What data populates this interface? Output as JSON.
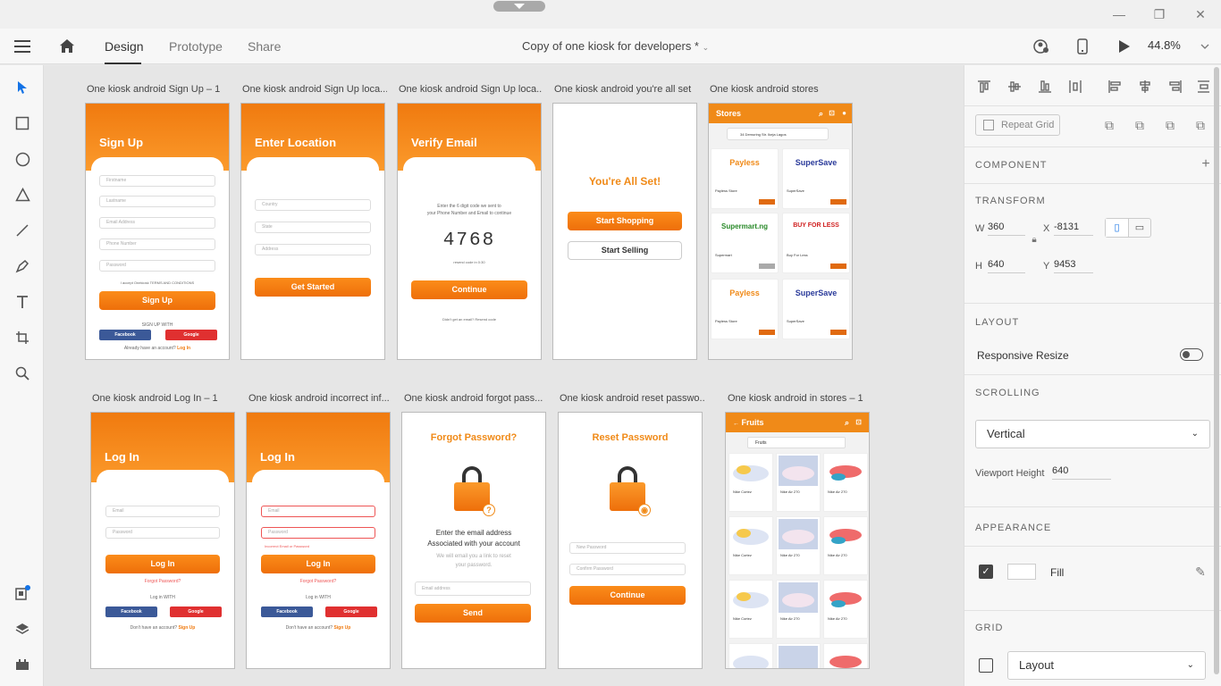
{
  "window": {
    "minimize": "—",
    "restore": "❐",
    "close": "✕"
  },
  "topbar": {
    "tabs": [
      "Design",
      "Prototype",
      "Share"
    ],
    "doc_title": "Copy of one kiosk for developers *",
    "zoom": "44.8%"
  },
  "artboards": {
    "signup": {
      "label": "One kiosk android Sign Up – 1",
      "title": "Sign Up",
      "fields": [
        "Firstname",
        "Lastname",
        "Email Address",
        "Phone Number",
        "Password"
      ],
      "terms": "I accept Onekiosk TERMS AND CONDITIONS",
      "button": "Sign Up",
      "signup_with": "SIGN UP WITH",
      "facebook": "Facebook",
      "google": "Google",
      "have_account": "Already have an account?",
      "login_link": "Log In"
    },
    "location": {
      "label": "One kiosk android Sign Up loca...",
      "title": "Enter Location",
      "fields": [
        "Country",
        "State",
        "Address"
      ],
      "button": "Get Started"
    },
    "verify": {
      "label": "One kiosk android Sign Up loca...",
      "title": "Verify Email",
      "desc1": "Enter the 6 digit code we sent to",
      "desc2": "your Phone Number and Email to continue",
      "code": "4768",
      "resend": "resend code in 0:30",
      "button": "Continue",
      "no_email": "Didn't get an email? Resend code"
    },
    "allset": {
      "label": "One kiosk android you're all set",
      "title": "You're All Set!",
      "btn_shop": "Start Shopping",
      "btn_sell": "Start Selling"
    },
    "stores": {
      "label": "One kiosk android stores",
      "title": "Stores",
      "location": "34 Demuring Str. Ikeja Lagos",
      "cards": [
        {
          "logo": "Payless",
          "name": "Payless Store",
          "color": "#f08a18"
        },
        {
          "logo": "SuperSave",
          "name": "SuperSave",
          "color": "#2a3a9a"
        },
        {
          "logo": "Supermart.ng",
          "name": "Supermart",
          "color": "#2a8a2a"
        },
        {
          "logo": "BUY FOR LESS",
          "name": "Buy For Less",
          "color": "#d02020"
        },
        {
          "logo": "Payless",
          "name": "Payless Store",
          "color": "#f08a18"
        },
        {
          "logo": "SuperSave",
          "name": "SuperSave",
          "color": "#2a3a9a"
        }
      ]
    },
    "login": {
      "label": "One kiosk android Log In – 1",
      "title": "Log In",
      "fields": [
        "Email",
        "Password"
      ],
      "button": "Log In",
      "forgot": "Forgot Password?",
      "login_with": "Log in WITH",
      "facebook": "Facebook",
      "google": "Google",
      "no_account": "Don't have an account?",
      "signup_link": "Sign Up"
    },
    "incorrect": {
      "label": "One kiosk android incorrect inf...",
      "title": "Log In",
      "fields": [
        "Email",
        "Password"
      ],
      "error": "Incorrect Email or Password",
      "button": "Log In",
      "forgot": "Forgot Password?",
      "login_with": "Log in WITH",
      "facebook": "Facebook",
      "google": "Google",
      "no_account": "Don't have an account?",
      "signup_link": "Sign Up"
    },
    "forgot": {
      "label": "One kiosk android forgot pass...",
      "title": "Forgot Password?",
      "desc1": "Enter the email address",
      "desc2": "Associated with your account",
      "desc3": "We will email you a link to reset",
      "desc4": "your password.",
      "field": "Email address",
      "button": "Send",
      "badge": "?"
    },
    "reset": {
      "label": "One kiosk android reset passwo...",
      "title": "Reset Password",
      "fields": [
        "New Password",
        "Confirm Password"
      ],
      "button": "Continue",
      "badge": "◉"
    },
    "fruits": {
      "label": "One kiosk android in stores – 1",
      "title": "Fruits",
      "filter": "Fruits",
      "items": [
        "Nike Cortez",
        "Nike Air 270",
        "Nike Air 270"
      ]
    }
  },
  "panel": {
    "repeat_grid": "Repeat Grid",
    "component": "COMPONENT",
    "transform": "TRANSFORM",
    "w_label": "W",
    "w": "360",
    "x_label": "X",
    "x": "-8131",
    "h_label": "H",
    "h": "640",
    "y_label": "Y",
    "y": "9453",
    "layout": "LAYOUT",
    "responsive": "Responsive Resize",
    "scrolling": "SCROLLING",
    "scroll_value": "Vertical",
    "viewport_label": "Viewport Height",
    "viewport": "640",
    "appearance": "APPEARANCE",
    "fill": "Fill",
    "grid": "GRID",
    "grid_value": "Layout"
  }
}
